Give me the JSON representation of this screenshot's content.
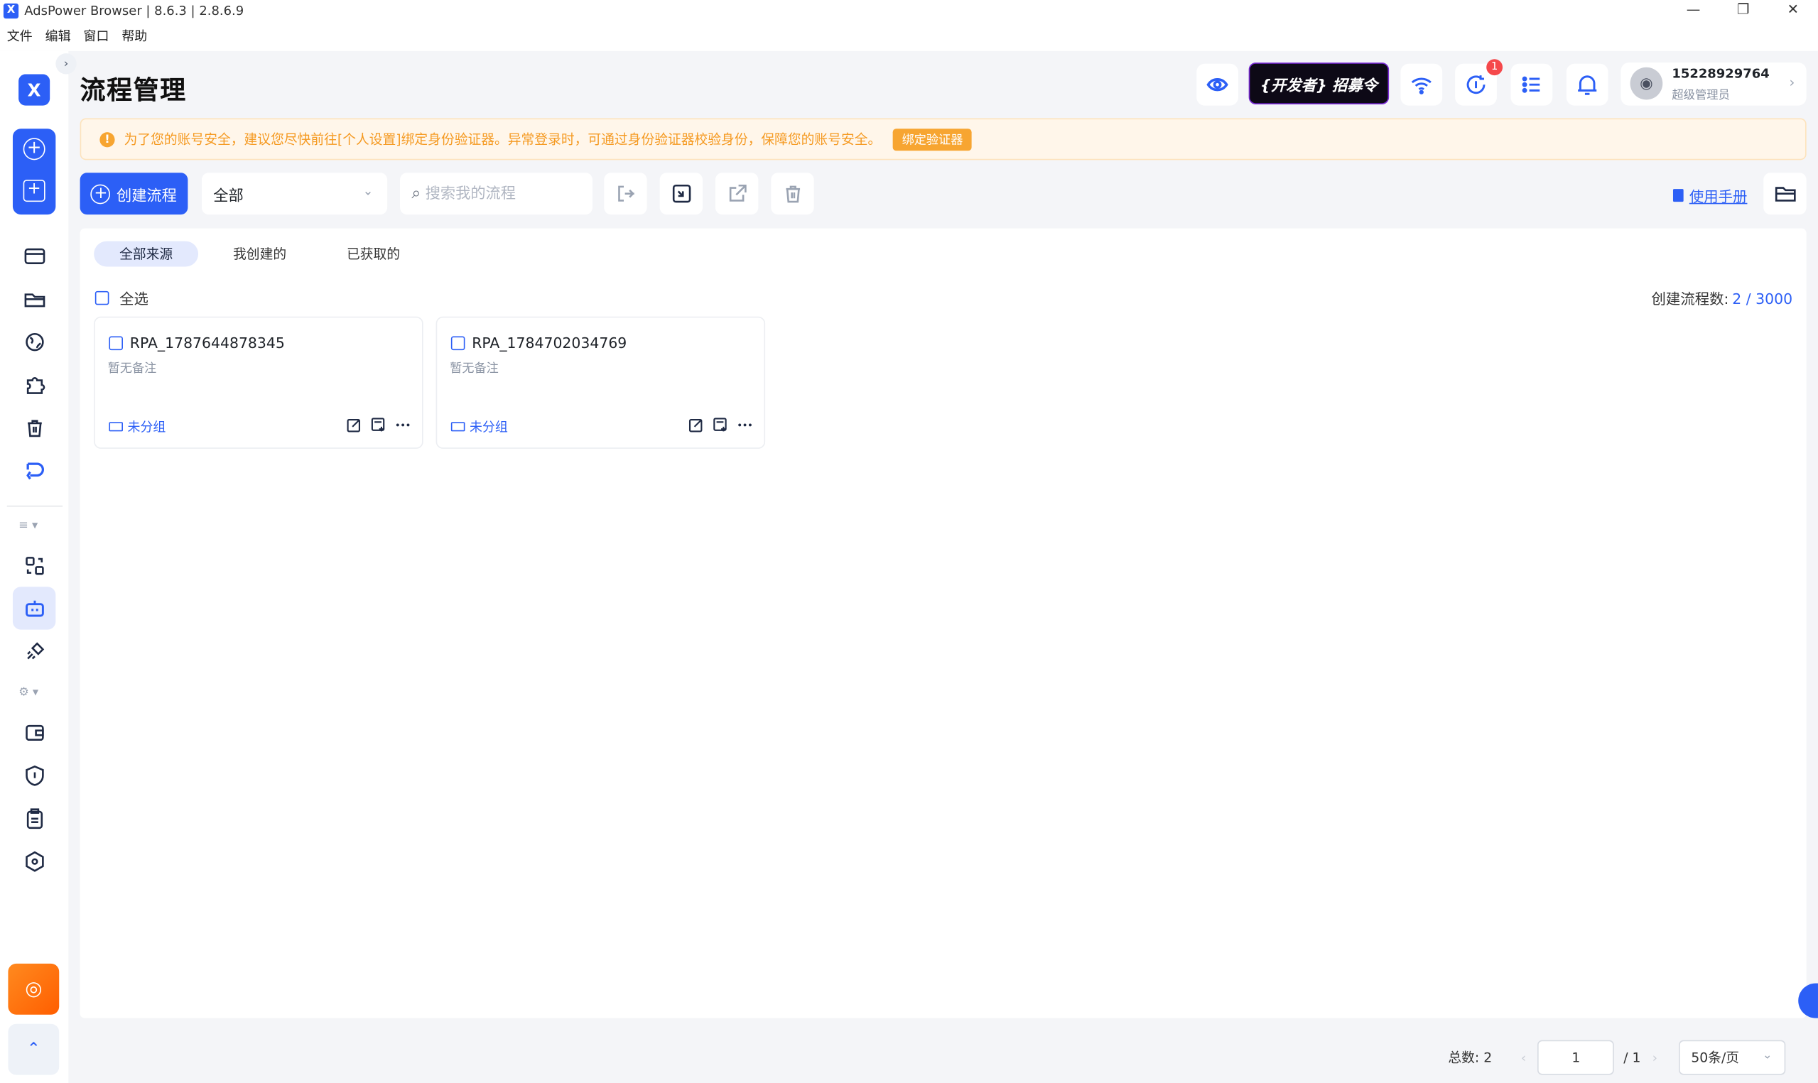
{
  "window": {
    "title": "AdsPower Browser | 8.6.3 | 2.8.6.9",
    "controls": [
      "—",
      "❐",
      "✕"
    ]
  },
  "menu": [
    "文件",
    "编辑",
    "窗口",
    "帮助"
  ],
  "sidebar": {
    "logo": "X",
    "expand_glyph": "›",
    "create_icons": [
      "+",
      "+"
    ],
    "groups": [
      "≡ ▾",
      "⚙ ▾"
    ],
    "coin_glyph": "◎",
    "switch_glyph": "⌃"
  },
  "header": {
    "page_title": "流程管理",
    "dev_banner": "{开发者} 招募令",
    "update_badge": "1",
    "user": {
      "phone": "15228929764",
      "role": "超级管理员",
      "avatar_glyph": "◉"
    }
  },
  "notice": {
    "text": "为了您的账号安全，建议您尽快前往[个人设置]绑定身份验证器。异常登录时，可通过身份验证器校验身份，保障您的账号安全。",
    "button": "绑定验证器",
    "colors": {
      "bg": "#fff6ea",
      "accent": "#f7a531"
    }
  },
  "toolbar": {
    "create_label": "创建流程",
    "group_select": "全部",
    "search_placeholder": "搜索我的流程",
    "manual_label": "使用手册",
    "icons": [
      "import-icon",
      "export-icon",
      "share-icon",
      "trash-icon",
      "folder-icon"
    ]
  },
  "tabs": [
    {
      "label": "全部来源",
      "active": true
    },
    {
      "label": "我创建的",
      "active": false
    },
    {
      "label": "已获取的",
      "active": false
    }
  ],
  "select_all": "全选",
  "count": {
    "label": "创建流程数:",
    "value": "2 / 3000"
  },
  "cards": [
    {
      "name": "RPA_1787644878345",
      "remark": "暂无备注",
      "group": "未分组"
    },
    {
      "name": "RPA_1784702034769",
      "remark": "暂无备注",
      "group": "未分组"
    }
  ],
  "pagination": {
    "total": "总数: 2",
    "prev": "‹",
    "next": "›",
    "page": "1",
    "pages": "/ 1",
    "page_size": "50条/页"
  },
  "accent_color": "#2c5ff6"
}
